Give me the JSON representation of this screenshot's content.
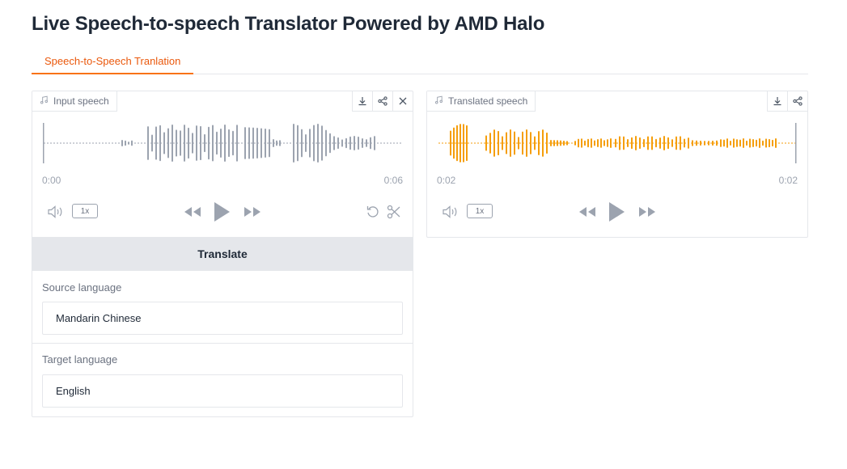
{
  "page": {
    "title": "Live Speech-to-speech Translator Powered by AMD Halo"
  },
  "tabs": [
    {
      "label": "Speech-to-Speech Tranlation",
      "active": true
    }
  ],
  "input_audio": {
    "label": "Input speech",
    "label_icon": "music-note-icon",
    "actions": [
      "download-icon",
      "share-icon",
      "close-icon"
    ],
    "time_current": "0:00",
    "time_total": "0:06",
    "playback_rate": "1x",
    "waveform_color": "#9ca3af",
    "controls": [
      "volume-icon",
      "rewind-icon",
      "play-icon",
      "fast-forward-icon",
      "undo-icon",
      "scissors-icon"
    ]
  },
  "translate_button": {
    "label": "Translate"
  },
  "source_language": {
    "label": "Source language",
    "value": "Mandarin Chinese"
  },
  "target_language": {
    "label": "Target language",
    "value": "English"
  },
  "output_audio": {
    "label": "Translated speech",
    "label_icon": "music-note-icon",
    "actions": [
      "download-icon",
      "share-icon"
    ],
    "time_current": "0:02",
    "time_total": "0:02",
    "playback_rate": "1x",
    "waveform_color": "#f59e0b",
    "controls": [
      "volume-icon",
      "rewind-icon",
      "play-icon",
      "fast-forward-icon"
    ]
  },
  "colors": {
    "accent": "#f97316",
    "accent_text": "#ea580c",
    "button_bg": "#e5e7eb",
    "border": "#e5e7eb",
    "muted_text": "#6b7280"
  }
}
